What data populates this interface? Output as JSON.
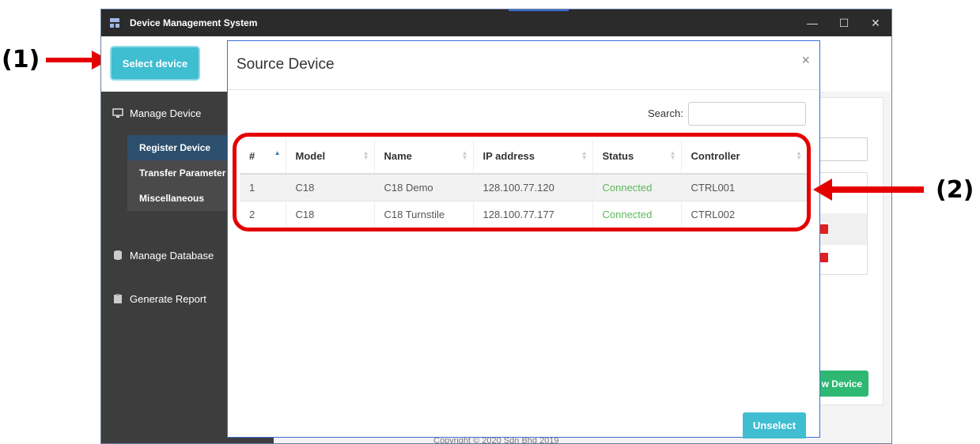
{
  "window": {
    "title": "Device Management System",
    "controls": [
      "—",
      "☐",
      "✕"
    ]
  },
  "callouts": {
    "one": "(1)",
    "two": "(2)"
  },
  "sidebar": {
    "select_device_label": "Select device",
    "items": [
      {
        "label": "Manage Device",
        "icon": "monitor-icon"
      },
      {
        "label": "Manage Database",
        "icon": "database-icon"
      },
      {
        "label": "Generate Report",
        "icon": "clipboard-icon"
      }
    ],
    "sub_items": [
      {
        "label": "Register Device",
        "active": true
      },
      {
        "label": "Transfer Parameter",
        "active": false
      },
      {
        "label": "Miscellaneous",
        "active": false
      }
    ]
  },
  "background": {
    "new_device_label": "w Device",
    "footer": "Copyright © 2020 Sdn Bhd 2019"
  },
  "modal": {
    "title": "Source Device",
    "close": "×",
    "search_label": "Search:",
    "search_value": "",
    "columns": [
      "#",
      "Model",
      "Name",
      "IP address",
      "Status",
      "Controller"
    ],
    "rows": [
      {
        "num": "1",
        "model": "C18",
        "name": "C18 Demo",
        "ip": "128.100.77.120",
        "status": "Connected",
        "controller": "CTRL001"
      },
      {
        "num": "2",
        "model": "C18",
        "name": "C18 Turnstile",
        "ip": "128.100.77.177",
        "status": "Connected",
        "controller": "CTRL002"
      }
    ],
    "unselect_label": "Unselect"
  },
  "colors": {
    "accent": "#3fbdd1",
    "annotation_red": "#e50000",
    "status_connected": "#5cb85c",
    "sidebar_bg": "#3d3d3d",
    "active_sub_bg": "#2d4f6e"
  }
}
